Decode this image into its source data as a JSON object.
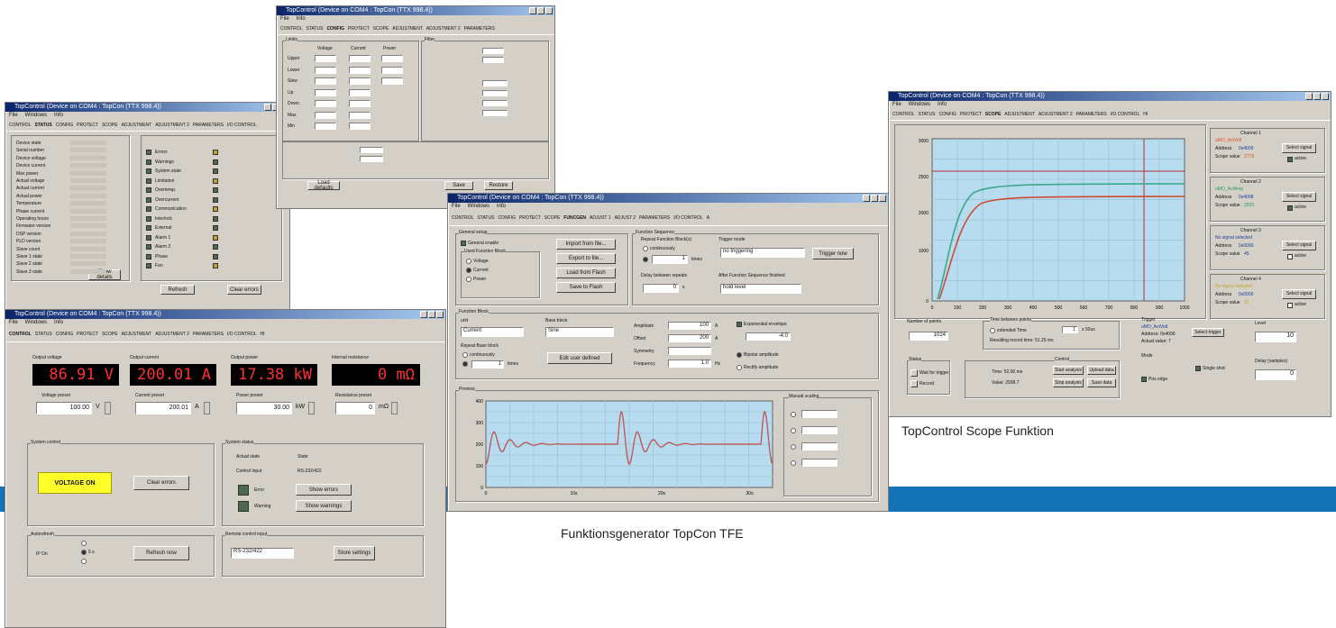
{
  "captions": {
    "scope": "TopControl Scope Funktion",
    "generator": "Funktionsgenerator TopCon TFE"
  },
  "colors": {
    "band": "#1472b6",
    "display_bg": "#000000",
    "display_text": "#ff3030",
    "graph_bg": "#b7dcef",
    "voltage_on": "#ffff2a"
  },
  "scope_window": {
    "title": "TopControl (Device on COM4 : TopCon (TTX 998.4))",
    "menu": [
      "File",
      "Windows",
      "Info"
    ],
    "tabs": [
      "CONTROL",
      "STATUS",
      "CONFIG",
      "PROTECT",
      "SCOPE",
      "ADJUSTMENT",
      "ADJUSTMENT 2",
      "PARAMETERS",
      "I/O CONTROL",
      "HI"
    ],
    "y_ticks": [
      "3000",
      "2500",
      "2000",
      "1000",
      "0"
    ],
    "x_ticks": [
      "0",
      "100",
      "200",
      "300",
      "400",
      "500",
      "600",
      "700",
      "800",
      "900",
      "1000"
    ],
    "channels": [
      {
        "title": "Channel 1",
        "signal": "uMO_ActVolt",
        "addr_label": "Address",
        "addr": "0x4000",
        "scope_label": "Scope value",
        "scope": "2778",
        "select": "Select signal",
        "active": "active",
        "color": "#e05020"
      },
      {
        "title": "Channel 2",
        "signal": "uMO_ActAmp",
        "addr_label": "Address",
        "addr": "0x4008",
        "scope_label": "Scope value",
        "scope": "2525",
        "select": "Select signal",
        "active": "active",
        "color": "#2a9a5a"
      },
      {
        "title": "Channel 3",
        "signal": "No signal selected",
        "addr_label": "Address",
        "addr": "0x0000",
        "scope_label": "Scope value",
        "scope": "45",
        "select": "Select signal",
        "active": "active",
        "color": "#1a3a9a"
      },
      {
        "title": "Channel 4",
        "signal": "No signal selected",
        "addr_label": "Address",
        "addr": "0x0000",
        "scope_label": "Scope value",
        "scope": "52",
        "select": "Select signal",
        "active": "active",
        "color": "#c8a020"
      }
    ],
    "number_of_points_label": "Number of points",
    "number_of_points": "1024",
    "time_between_label": "Time between points",
    "extended_time": "extended Time",
    "time_value": "1",
    "time_unit": "x 50us",
    "resulting_label": "Resulting record time: 51.20 ms",
    "trigger_label": "Trigger",
    "trigger_signal": "uMO_ActVolt",
    "trigger_addr": "Address: 0x4000",
    "trigger_actual": "Actual value: 7",
    "select_trigger": "Select trigger",
    "level_label": "Level",
    "level_value": "10",
    "status_label": "Status",
    "wait_trigger": "Wait for trigger",
    "record": "Record",
    "control_label": "Control",
    "time_line": "Time: 52.06 ms",
    "value_line": "Value: 2938.7",
    "start_analysis": "Start analysis",
    "stop_analysis": "Stop analysis",
    "upload_data": "Upload data",
    "save_data": "Save data",
    "mode_label": "Mode",
    "single_shot": "Single shot",
    "pos_edge": "Pos edge",
    "delay_label": "Delay (samples)",
    "delay_value": "0"
  },
  "gen_window": {
    "title": "TopControl (Device on COM4 : TopCon (TTX 998.4))",
    "menu": [
      "File",
      "Windows",
      "Info"
    ],
    "tabs": [
      "CONTROL",
      "STATUS",
      "CONFIG",
      "PROTECT",
      "SCOPE",
      "FUNCGEN",
      "ADJUST 1",
      "ADJUST 2",
      "PARAMETERS",
      "I/O CONTROL",
      "A"
    ],
    "general_setup": "General setup",
    "general_enable": "General enable",
    "used_function": "Used Function Block",
    "voltage": "Voltage",
    "current": "Current",
    "power": "Power",
    "import_file": "Import from file...",
    "export_file": "Export to file...",
    "load_flash": "Load from Flash",
    "save_flash": "Save to Flash",
    "function_sequence": "Function Sequence",
    "repeat_function": "Repeat Function Block(s)",
    "continuously": "continuously",
    "times": "times",
    "repeat_value": "1",
    "trigger_mode": "Trigger mode",
    "trigger_mode_value": "no triggering",
    "trigger_now": "Trigger now",
    "delay_repeats": "Delay between repeats",
    "delay_value": "0",
    "delay_unit": "s",
    "after_sequence": "After Function Sequence finished",
    "after_value": "hold level",
    "function_block": "Function Block",
    "unit": "unit",
    "unit_value": "Current",
    "base_block": "Base block",
    "base_value": "Sine",
    "repeat_base": "Repeat Base block",
    "edit_defined": "Edit user defined",
    "amplitude": "Amplitude",
    "amplitude_value": "100",
    "offset": "Offset",
    "offset_value": "200",
    "symmetry": "Symmetry",
    "frequency": "Frequency",
    "frequency_value": "1.0",
    "amp_unit": "A",
    "freq_unit": "Hz",
    "exp_envelope": "Exponential envelope",
    "exp_value": "-4.0",
    "bipolar": "Bipolar amplitude",
    "rectify": "Rectify amplitude",
    "preview": "Preview",
    "manual_scaling": "Manual scaling",
    "y_ticks": [
      "400",
      "300",
      "200",
      "100",
      "0"
    ],
    "x_ticks": [
      "0",
      "10s",
      "20s",
      "30s"
    ]
  },
  "control_window": {
    "title": "TopControl (Device on COM4 : TopCon (TTX 998.4))",
    "menu": [
      "File",
      "Windows",
      "Info"
    ],
    "tabs": [
      "CONTROL",
      "STATUS",
      "CONFIG",
      "PROTECT",
      "SCOPE",
      "ADJUSTMENT",
      "ADJUSTMENT 2",
      "PARAMETERS",
      "I/O CONTROL",
      "HI"
    ],
    "output_voltage_label": "Output voltage",
    "output_voltage": "86.91 V",
    "output_current_label": "Output current",
    "output_current": "200.01 A",
    "output_power_label": "Output power",
    "output_power": "17.38 kW",
    "internal_res_label": "Internal resistance",
    "internal_res": "0 mΩ",
    "voltage_preset_label": "Voltage preset",
    "voltage_preset": "100.00",
    "voltage_unit": "V",
    "current_preset_label": "Current preset",
    "current_preset": "200.01",
    "current_unit": "A",
    "power_preset_label": "Power preset",
    "power_preset": "30.00",
    "power_unit": "kW",
    "resistance_preset_label": "Resistance preset",
    "resistance_preset": "0",
    "resistance_unit": "mΩ",
    "system_control": "System control",
    "voltage_on": "VOLTAGE ON",
    "clear_errors": "Clear errors",
    "system_status": "System status",
    "actual_state": "Actual state",
    "state_label": "State",
    "control_input": "Control input",
    "control_input_value": "RS-232/422",
    "error": "Error",
    "warning": "Warning",
    "show_errors": "Show errors",
    "show_warnings": "Show warnings",
    "autorefresh": "Autorefresh",
    "refresh_rate": "5 s",
    "autorefresh_state": "IP On",
    "refresh_now": "Refresh now",
    "remote_control": "Remote control input",
    "remote_value": "RS-232/422",
    "store_settings": "Store settings"
  },
  "status_window": {
    "title": "TopControl (Device on COM4 : TopCon (TTX 998.4))",
    "menu": [
      "File",
      "Windows",
      "Info"
    ],
    "tabs": [
      "CONTROL",
      "STATUS",
      "CONFIG",
      "PROTECT",
      "SCOPE",
      "ADJUSTMENT",
      "ADJUSTMENT 2",
      "PARAMETERS",
      "I/O CONTROL",
      "HI"
    ],
    "rows": [
      "Device state",
      "Serial number",
      "Device voltage",
      "Device current",
      "Max power",
      "Actual voltage",
      "Actual current",
      "Actual power",
      "Temperature",
      "Phase current",
      "Operating hours",
      "Firmware version",
      "DSP version",
      "PLD version",
      "Slave count",
      "Slave 1 state",
      "Slave 2 state",
      "Slave 3 state"
    ],
    "errors": [
      "Errors",
      "Warnings",
      "System state",
      "Limitation",
      "Overtemp.",
      "Overcurrent",
      "Communication",
      "Interlock",
      "External",
      "Alarm 1",
      "Alarm 2",
      "Phase",
      "Fan"
    ],
    "refresh": "Refresh",
    "show_details": "Show details",
    "clear_errors": "Clear errors"
  },
  "config_window": {
    "title": "TopControl (Device on COM4 : TopCon (TTX 998.4))",
    "menu": [
      "File",
      "Info"
    ],
    "tabs": [
      "CONTROL",
      "STATUS",
      "CONFIG",
      "PROTECT",
      "SCOPE",
      "ADJUSTMENT",
      "ADJUSTMENT 2",
      "PARAMETERS",
      "I/O CONTROL",
      "H"
    ],
    "limits": "Limits",
    "voltage": "Voltage",
    "current": "Current",
    "power": "Power",
    "filter": "Filter",
    "rows": [
      "Upper",
      "Lower",
      "Slew",
      "Up",
      "Down",
      "Max",
      "Min"
    ],
    "load_defaults": "Load defaults",
    "save": "Save",
    "restore": "Restore"
  }
}
